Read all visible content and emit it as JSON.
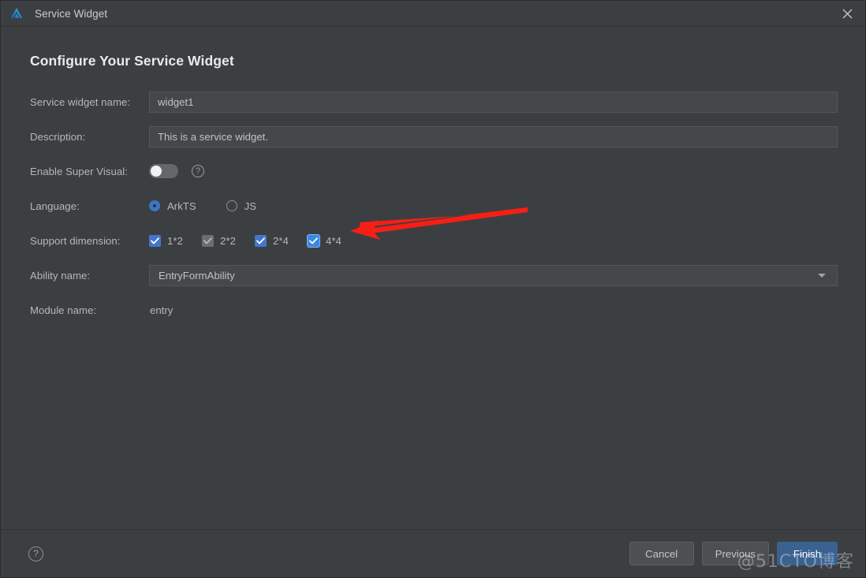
{
  "window": {
    "title": "Service Widget",
    "logo_icon": "deveco-logo-icon",
    "close_icon": "close-icon",
    "bg_color": "#3c3f41"
  },
  "page": {
    "heading": "Configure Your Service Widget"
  },
  "form": {
    "widget_name": {
      "label": "Service widget name:",
      "value": "widget1",
      "placeholder": "widget1"
    },
    "description": {
      "label": "Description:",
      "value": "This is a service widget.",
      "placeholder": "This is a service widget."
    },
    "super_visual": {
      "label": "Enable Super Visual:",
      "state": "off",
      "help_icon": "question-mark-icon",
      "help_glyph": "?"
    },
    "language": {
      "label": "Language:",
      "selected": "ArkTS",
      "options": [
        {
          "label": "ArkTS",
          "selected": true
        },
        {
          "label": "JS",
          "selected": false
        }
      ]
    },
    "support_dimension": {
      "label": "Support dimension:",
      "options": [
        {
          "label": "1*2",
          "checked": true,
          "disabled": false,
          "focused": false
        },
        {
          "label": "2*2",
          "checked": true,
          "disabled": true,
          "focused": false
        },
        {
          "label": "2*4",
          "checked": true,
          "disabled": false,
          "focused": false
        },
        {
          "label": "4*4",
          "checked": true,
          "disabled": false,
          "focused": true
        }
      ]
    },
    "ability_name": {
      "label": "Ability name:",
      "value": "EntryFormAbility",
      "arrow_icon": "chevron-down-icon"
    },
    "module_name": {
      "label": "Module name:",
      "value": "entry"
    }
  },
  "footer": {
    "help_icon": "question-mark-icon",
    "help_glyph": "?",
    "cancel_label": "Cancel",
    "previous_label": "Previous",
    "finish_label": "Finish",
    "primary_color": "#3b6191"
  },
  "annotation": {
    "arrow_icon": "red-arrow-left-icon",
    "color": "#f61f15"
  },
  "watermark": {
    "text": "@51CTO博客"
  }
}
